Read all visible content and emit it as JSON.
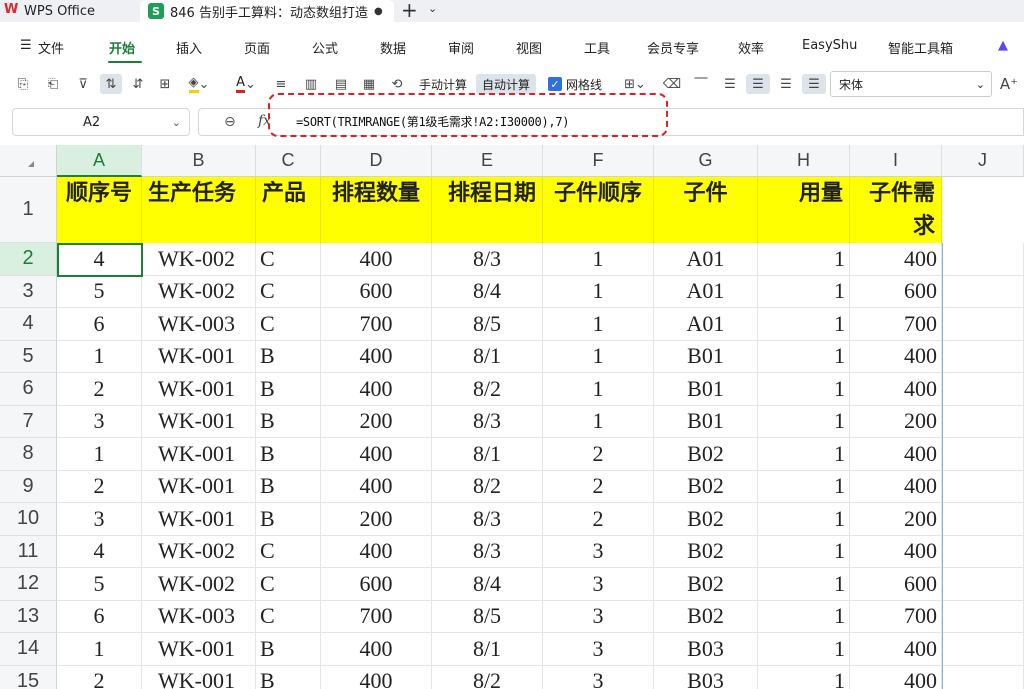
{
  "app": {
    "name": "WPS Office",
    "doc_tab": "846 告别手工算料：动态数组打造",
    "tab_more": "⌄"
  },
  "menu": [
    "文件",
    "开始",
    "插入",
    "页面",
    "公式",
    "数据",
    "审阅",
    "视图",
    "工具",
    "会员专享",
    "效率",
    "EasyShu",
    "智能工具箱"
  ],
  "toolbar": {
    "manual_calc": "手动计算",
    "auto_calc": "自动计算",
    "gridlines": "网格线",
    "font": "宋体"
  },
  "formula_bar": {
    "cell_ref": "A2",
    "fx": "fx",
    "formula": "=SORT(TRIMRANGE(第1级毛需求!A2:I30000),7)"
  },
  "columns": [
    "A",
    "B",
    "C",
    "D",
    "E",
    "F",
    "G",
    "H",
    "I",
    "J"
  ],
  "headers": [
    "顺序号",
    "生产任务",
    "产品",
    "排程数量",
    "排程日期",
    "子件顺序",
    "子件",
    "用量",
    "子件需求"
  ],
  "rows": [
    {
      "n": "2",
      "cells": [
        "4",
        "WK-002",
        "C",
        "400",
        "8/3",
        "1",
        "A01",
        "1",
        "400"
      ]
    },
    {
      "n": "3",
      "cells": [
        "5",
        "WK-002",
        "C",
        "600",
        "8/4",
        "1",
        "A01",
        "1",
        "600"
      ]
    },
    {
      "n": "4",
      "cells": [
        "6",
        "WK-003",
        "C",
        "700",
        "8/5",
        "1",
        "A01",
        "1",
        "700"
      ]
    },
    {
      "n": "5",
      "cells": [
        "1",
        "WK-001",
        "B",
        "400",
        "8/1",
        "1",
        "B01",
        "1",
        "400"
      ]
    },
    {
      "n": "6",
      "cells": [
        "2",
        "WK-001",
        "B",
        "400",
        "8/2",
        "1",
        "B01",
        "1",
        "400"
      ]
    },
    {
      "n": "7",
      "cells": [
        "3",
        "WK-001",
        "B",
        "200",
        "8/3",
        "1",
        "B01",
        "1",
        "200"
      ]
    },
    {
      "n": "8",
      "cells": [
        "1",
        "WK-001",
        "B",
        "400",
        "8/1",
        "2",
        "B02",
        "1",
        "400"
      ]
    },
    {
      "n": "9",
      "cells": [
        "2",
        "WK-001",
        "B",
        "400",
        "8/2",
        "2",
        "B02",
        "1",
        "400"
      ]
    },
    {
      "n": "10",
      "cells": [
        "3",
        "WK-001",
        "B",
        "200",
        "8/3",
        "2",
        "B02",
        "1",
        "200"
      ]
    },
    {
      "n": "11",
      "cells": [
        "4",
        "WK-002",
        "C",
        "400",
        "8/3",
        "3",
        "B02",
        "1",
        "400"
      ]
    },
    {
      "n": "12",
      "cells": [
        "5",
        "WK-002",
        "C",
        "600",
        "8/4",
        "3",
        "B02",
        "1",
        "600"
      ]
    },
    {
      "n": "13",
      "cells": [
        "6",
        "WK-003",
        "C",
        "700",
        "8/5",
        "3",
        "B02",
        "1",
        "700"
      ]
    },
    {
      "n": "14",
      "cells": [
        "1",
        "WK-001",
        "B",
        "400",
        "8/1",
        "3",
        "B03",
        "1",
        "400"
      ]
    },
    {
      "n": "15",
      "cells": [
        "2",
        "WK-001",
        "B",
        "400",
        "8/2",
        "3",
        "B03",
        "1",
        "400"
      ]
    }
  ],
  "colors": {
    "accent": "#1a7f37",
    "header_fill": "#ffff00",
    "highlight": "#e02020"
  }
}
